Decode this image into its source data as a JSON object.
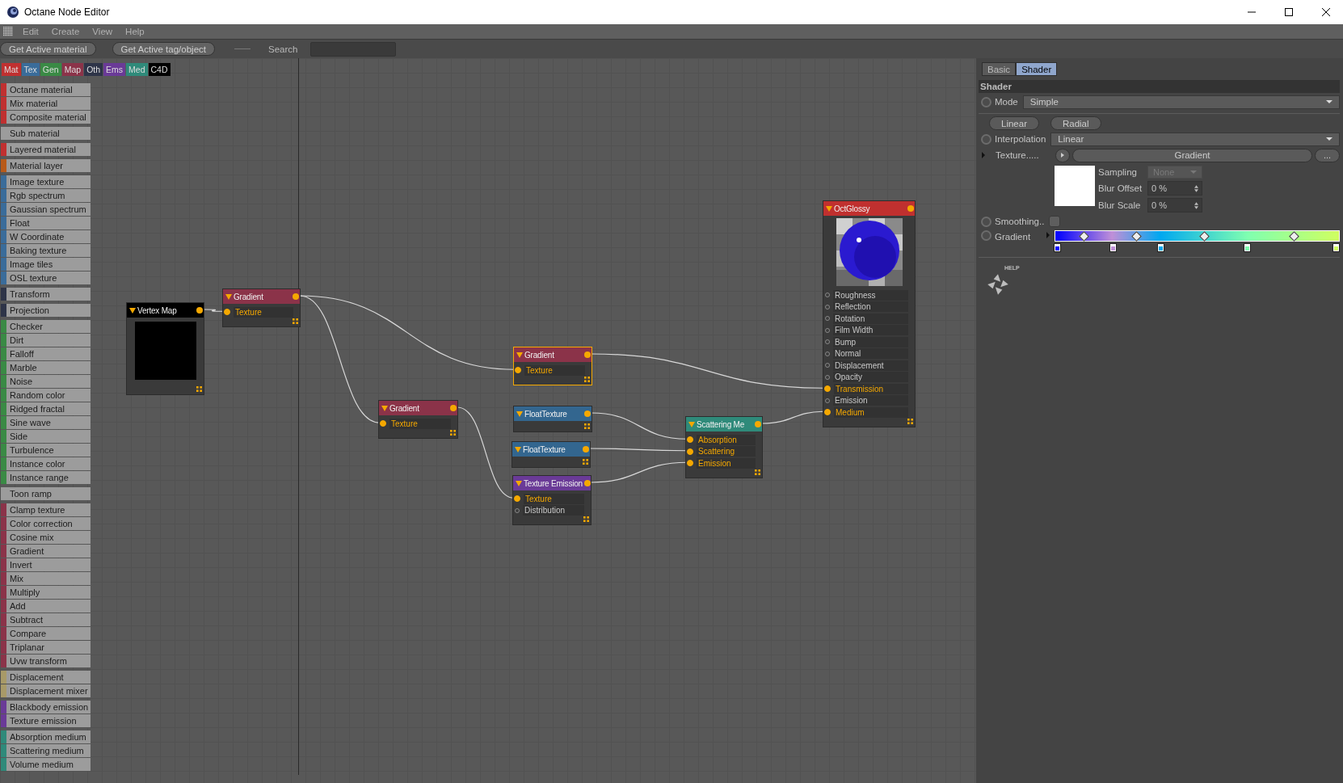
{
  "window": {
    "title": "Octane Node Editor"
  },
  "menu": [
    "Edit",
    "Create",
    "View",
    "Help"
  ],
  "toolbar": {
    "buttons": [
      "Get Active material",
      "Get Active tag/object"
    ],
    "search_label": "Search"
  },
  "categories": [
    {
      "label": "Mat",
      "color": "#c03030"
    },
    {
      "label": "Tex",
      "color": "#3a6c9a"
    },
    {
      "label": "Gen",
      "color": "#3a8a45"
    },
    {
      "label": "Map",
      "color": "#8b3349"
    },
    {
      "label": "Oth",
      "color": "#2e3448"
    },
    {
      "label": "Ems",
      "color": "#6a3a97"
    },
    {
      "label": "Med",
      "color": "#2f8a7a"
    },
    {
      "label": "C4D",
      "color": "#000000"
    }
  ],
  "sidebar": {
    "groups": [
      {
        "color": "#c03030",
        "items": [
          "Octane material",
          "Mix material",
          "Composite material"
        ]
      },
      {
        "items": [
          "Sub material"
        ]
      },
      {
        "color": "#c03030",
        "items": [
          "Layered material"
        ]
      },
      {
        "color": "#b85a1a",
        "items": [
          "Material layer"
        ]
      },
      {
        "color": "#3a6c9a",
        "items": [
          "Image texture",
          "Rgb spectrum",
          "Gaussian spectrum",
          "Float",
          "W Coordinate",
          "Baking texture",
          "Image tiles",
          "OSL texture"
        ]
      },
      {
        "color": "#2e3448",
        "items": [
          "Transform"
        ]
      },
      {
        "color": "#2e3448",
        "items": [
          "Projection"
        ]
      },
      {
        "color": "#3a8a45",
        "items": [
          "Checker",
          "Dirt",
          "Falloff",
          "Marble",
          "Noise",
          "Random color",
          "Ridged fractal",
          "Sine wave",
          "Side",
          "Turbulence",
          "Instance color",
          "Instance range"
        ]
      },
      {
        "items": [
          "Toon ramp"
        ]
      },
      {
        "color": "#8b3349",
        "items": [
          "Clamp texture",
          "Color correction",
          "Cosine mix",
          "Gradient",
          "Invert",
          "Mix",
          "Multiply",
          "Add",
          "Subtract",
          "Compare",
          "Triplanar",
          "Uvw transform"
        ]
      },
      {
        "color": "#a89a68",
        "items": [
          "Displacement",
          "Displacement mixer"
        ]
      },
      {
        "color": "#6a3a97",
        "items": [
          "Blackbody emission",
          "Texture emission"
        ]
      },
      {
        "color": "#2f8a7a",
        "items": [
          "Absorption medium",
          "Scattering medium",
          "Volume medium"
        ]
      }
    ]
  },
  "nodes": [
    {
      "title": "Vertex Map",
      "color": "#000000",
      "kind": "swatch",
      "selected": false
    },
    {
      "title": "Gradient",
      "color": "#8b3349",
      "kind": "plain",
      "selected": false,
      "inputs": [
        {
          "label": "Texture",
          "connected": true
        }
      ]
    },
    {
      "title": "Gradient",
      "color": "#8b3349",
      "kind": "plain",
      "selected": true,
      "inputs": [
        {
          "label": "Texture",
          "connected": true
        }
      ]
    },
    {
      "title": "Gradient",
      "color": "#8b3349",
      "kind": "plain",
      "selected": false,
      "inputs": [
        {
          "label": "Texture",
          "connected": true
        }
      ]
    },
    {
      "title": "FloatTexture",
      "color": "#33668f",
      "kind": "plain",
      "selected": false
    },
    {
      "title": "FloatTexture",
      "color": "#33668f",
      "kind": "plain",
      "selected": false
    },
    {
      "title": "Texture Emission",
      "color": "#6a3a97",
      "kind": "plain",
      "selected": false,
      "inputs": [
        {
          "label": "Texture",
          "connected": true
        },
        {
          "label": "Distribution",
          "connected": false
        }
      ]
    },
    {
      "title": "Scattering Me",
      "color": "#2f8a7a",
      "kind": "plain",
      "selected": false,
      "inputs": [
        {
          "label": "Absorption",
          "connected": true
        },
        {
          "label": "Scattering",
          "connected": true
        },
        {
          "label": "Emission",
          "connected": true
        }
      ]
    },
    {
      "title": "OctGlossy",
      "color": "#c0302f",
      "kind": "picture",
      "selected": false,
      "inputs": [
        {
          "label": "Roughness",
          "connected": false
        },
        {
          "label": "Reflection",
          "connected": false
        },
        {
          "label": "Rotation",
          "connected": false
        },
        {
          "label": "Film Width",
          "connected": false
        },
        {
          "label": "Bump",
          "connected": false
        },
        {
          "label": "Normal",
          "connected": false
        },
        {
          "label": "Displacement",
          "connected": false
        },
        {
          "label": "Opacity",
          "connected": false
        },
        {
          "label": "Transmission",
          "connected": true
        },
        {
          "label": "Emission",
          "connected": false
        },
        {
          "label": "Medium",
          "connected": true
        }
      ]
    }
  ],
  "panel": {
    "tabs": [
      {
        "label": "Basic",
        "selected": false
      },
      {
        "label": "Shader",
        "selected": true
      }
    ],
    "section": "Shader",
    "mode": {
      "label": "Mode",
      "value": "Simple"
    },
    "buttons": [
      "Linear",
      "Radial"
    ],
    "interpolation": {
      "label": "Interpolation",
      "value": "Linear"
    },
    "texture": {
      "label": "Texture.....",
      "value": "Gradient",
      "more": "..."
    },
    "sampling": {
      "label": "Sampling",
      "value": "None",
      "disabled": true
    },
    "blur_offset": {
      "label": "Blur Offset",
      "value": "0 %"
    },
    "blur_scale": {
      "label": "Blur Scale",
      "value": "0 %"
    },
    "smoothing": {
      "label": "Smoothing..",
      "checked": false
    },
    "gradient": {
      "label": "Gradient",
      "stops": [
        {
          "color": "#0000ff"
        },
        {
          "color": "#c090d8"
        },
        {
          "color": "#00a8f0"
        },
        {
          "color": "#80ffb0"
        },
        {
          "color": "#d0ff60"
        }
      ]
    },
    "help": "HELP"
  }
}
